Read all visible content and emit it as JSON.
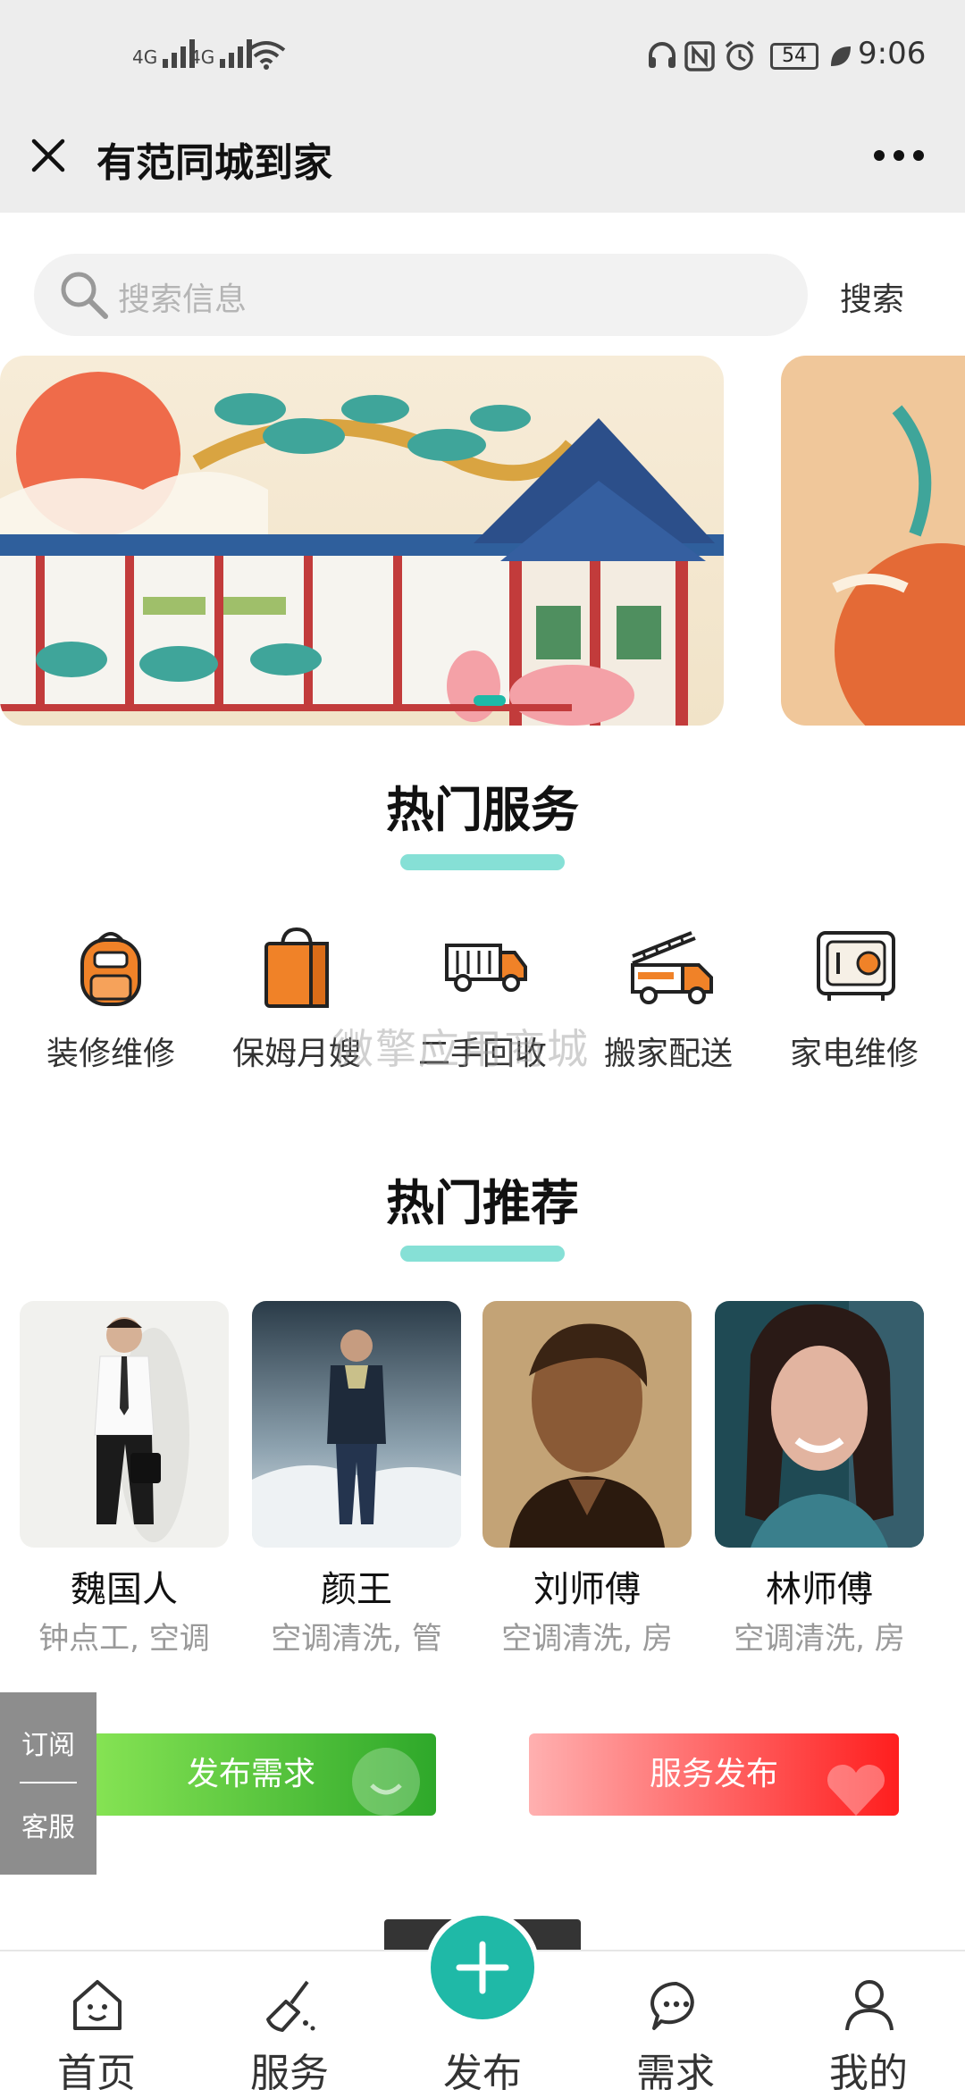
{
  "status_bar": {
    "network_1": "4G",
    "network_2": "4G",
    "battery": "54",
    "time": "9:06"
  },
  "nav": {
    "title": "有范同城到家"
  },
  "search": {
    "placeholder": "搜索信息",
    "button": "搜索"
  },
  "hot_services": {
    "title": "热门服务",
    "items": [
      {
        "label": "装修维修",
        "icon": "backpack-icon"
      },
      {
        "label": "保姆月嫂",
        "icon": "shopping-bag-icon"
      },
      {
        "label": "二手回收",
        "icon": "truck-icon"
      },
      {
        "label": "搬家配送",
        "icon": "ladder-truck-icon"
      },
      {
        "label": "家电维修",
        "icon": "safe-icon"
      }
    ]
  },
  "watermark": "微擎应用商城",
  "hot_recommend": {
    "title": "热门推荐",
    "people": [
      {
        "name": "魏国人",
        "desc": "钟点工, 空调"
      },
      {
        "name": "颜王",
        "desc": "空调清洗, 管"
      },
      {
        "name": "刘师傅",
        "desc": "空调清洗, 房"
      },
      {
        "name": "林师傅",
        "desc": "空调清洗, 房"
      }
    ]
  },
  "side_tab": {
    "top": "订阅",
    "bottom": "客服"
  },
  "actions": {
    "publish_demand": "发布需求",
    "publish_service": "服务发布"
  },
  "bottom_nav": [
    {
      "label": "首页",
      "icon": "home-icon"
    },
    {
      "label": "服务",
      "icon": "broom-icon"
    },
    {
      "label": "发布",
      "icon": "plus-icon"
    },
    {
      "label": "需求",
      "icon": "chat-bubble-icon"
    },
    {
      "label": "我的",
      "icon": "user-icon"
    }
  ],
  "colors": {
    "accent": "#1fb9a7",
    "section_bar": "#86e0d6",
    "green_button": "#36b32a",
    "red_button": "#ff2a2a",
    "icon_orange": "#f08228"
  }
}
